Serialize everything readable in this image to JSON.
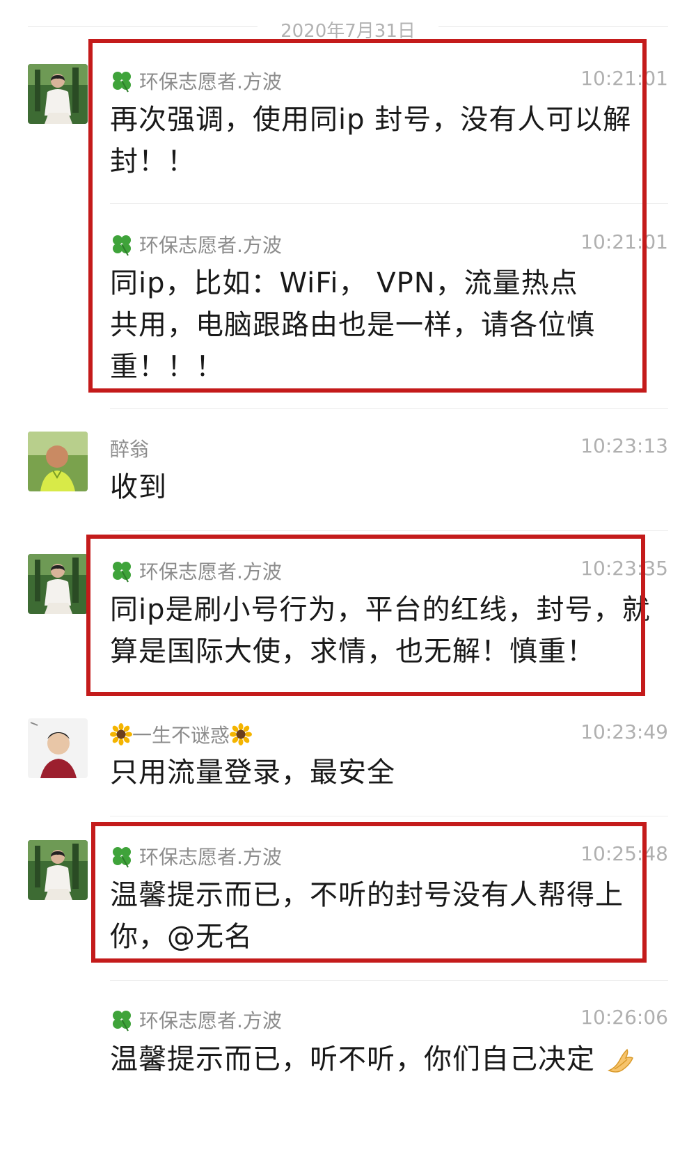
{
  "date_divider": "2020年7月31日",
  "messages": [
    {
      "sender": "环保志愿者.方波",
      "time": "10:21:01",
      "text": "再次强调，使用同ip 封号，没有人可以解封！！"
    },
    {
      "sender": "环保志愿者.方波",
      "time": "10:21:01",
      "text": "同ip，比如：WiFi， VPN，流量热点共用，电脑跟路由也是一样，请各位慎重！！！"
    },
    {
      "sender": "醉翁",
      "time": "10:23:13",
      "text": "收到"
    },
    {
      "sender": "环保志愿者.方波",
      "time": "10:23:35",
      "text": "同ip是刷小号行为，平台的红线，封号，就算是国际大使，求情，也无解！慎重！"
    },
    {
      "sender": "一生不谜惑",
      "time": "10:23:49",
      "text": "只用流量登录，最安全"
    },
    {
      "sender": "环保志愿者.方波",
      "time": "10:25:48",
      "text": "温馨提示而已，不听的封号没有人帮得上你，@无名"
    },
    {
      "sender": "环保志愿者.方波",
      "time": "10:26:06",
      "text": "温馨提示而已，听不听，你们自己决定"
    }
  ],
  "colors": {
    "highlight": "#c41b1b",
    "sender": "#8c8c8c",
    "time": "#b0b0b0",
    "text": "#191919"
  },
  "icons": {
    "sender_prefix": "four-leaf-clover-icon",
    "name_decoration": "sunflower-icon",
    "trailing_emoji": "folded-hands-icon"
  }
}
